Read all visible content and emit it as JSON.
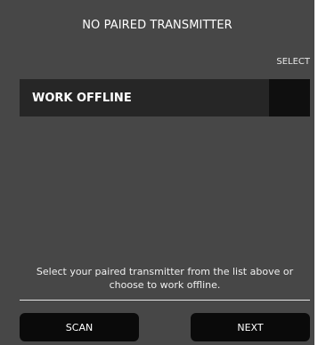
{
  "header": {
    "title": "NO PAIRED TRANSMITTER"
  },
  "list": {
    "column_header": "SELECT",
    "items": [
      {
        "label": "WORK OFFLINE"
      }
    ]
  },
  "instruction_text": "Select your paired transmitter from the list above or choose to work offline.",
  "buttons": {
    "scan_label": "SCAN",
    "next_label": "NEXT"
  },
  "colors": {
    "background": "#474747",
    "row_background": "#262626",
    "select_cell": "#0f0f0f",
    "button_background": "#0a0a0a",
    "text": "#ffffff"
  }
}
